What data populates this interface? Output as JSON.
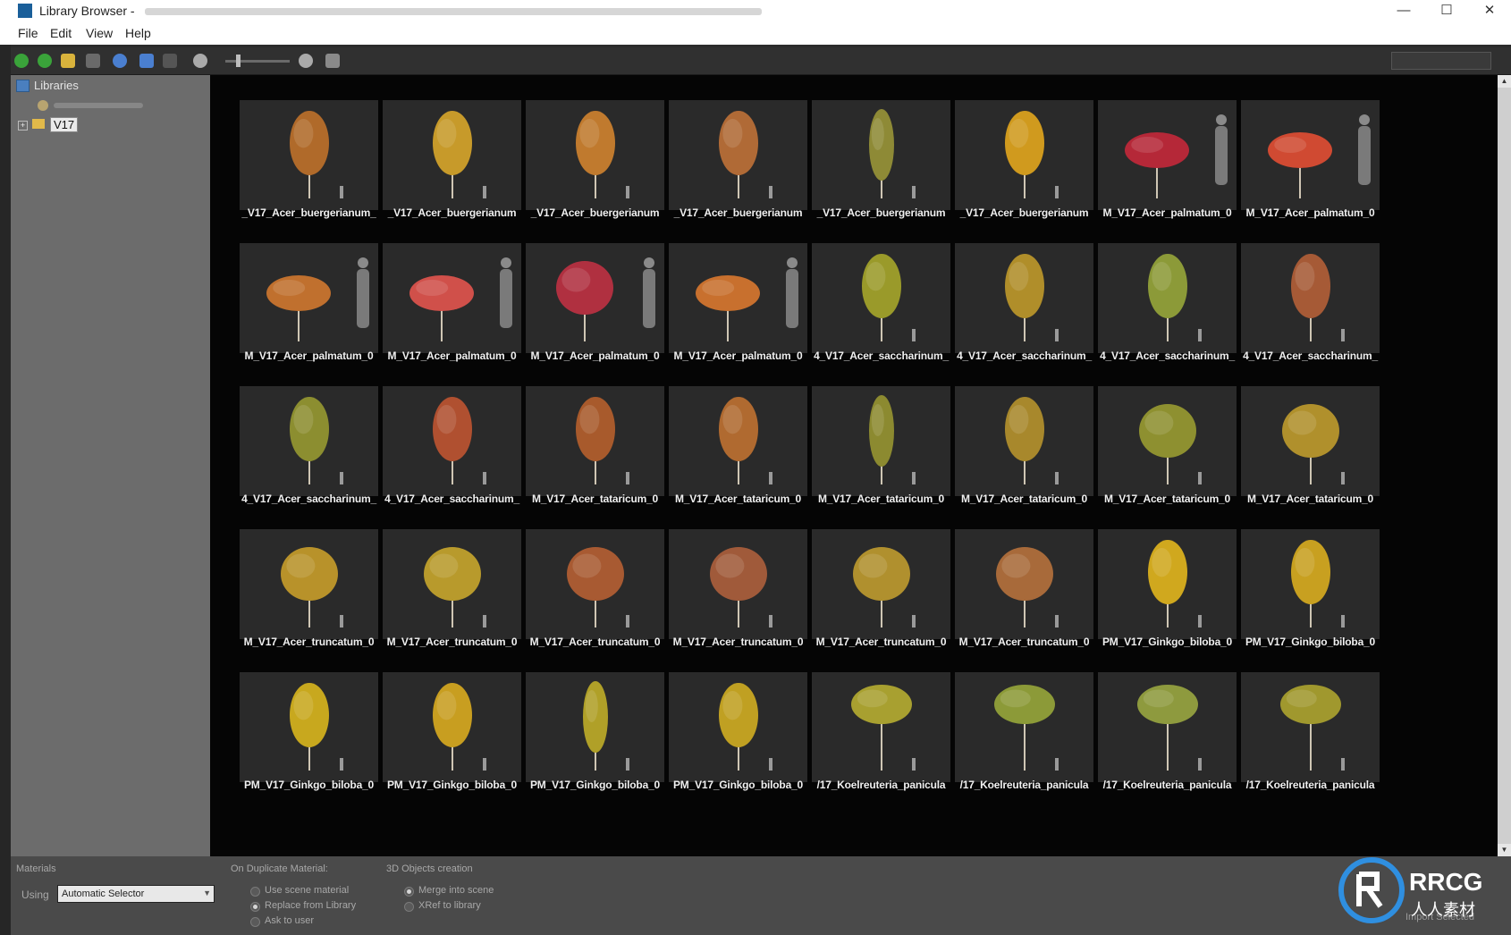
{
  "window": {
    "title": "Library Browser -",
    "controls": {
      "minimize": "—",
      "maximize": "☐",
      "close": "✕"
    }
  },
  "menu": {
    "file": "File",
    "edit": "Edit",
    "view": "View",
    "help": "Help"
  },
  "toolbar": {
    "icons": [
      "back-icon",
      "forward-icon",
      "folder-open-icon",
      "save-icon",
      "refresh-icon",
      "upload-icon",
      "export-icon",
      "zoom-out-icon",
      "zoom-slider",
      "zoom-in-icon",
      "settings-icon"
    ],
    "colors": {
      "green": "#3aa33a",
      "gray": "#7a7a7a",
      "blue": "#4a7fd0",
      "yellow": "#d9b33c"
    }
  },
  "tree": {
    "header": "Libraries",
    "selected_folder": "V17",
    "expander": "+"
  },
  "grid": {
    "items": [
      {
        "label": "_V17_Acer_buergerianum_",
        "color": "#b06a2a",
        "shape": "tall",
        "person": false
      },
      {
        "label": "_V17_Acer_buergerianum",
        "color": "#c79a2a",
        "shape": "tall",
        "person": false
      },
      {
        "label": "_V17_Acer_buergerianum",
        "color": "#c07a2e",
        "shape": "tall",
        "person": false
      },
      {
        "label": "_V17_Acer_buergerianum",
        "color": "#b06a36",
        "shape": "tall",
        "person": false
      },
      {
        "label": "_V17_Acer_buergerianum",
        "color": "#8e8a36",
        "shape": "slim",
        "person": false
      },
      {
        "label": "_V17_Acer_buergerianum",
        "color": "#d09a1e",
        "shape": "tall",
        "person": false
      },
      {
        "label": "M_V17_Acer_palmatum_0",
        "color": "#b52838",
        "shape": "wide",
        "person": true
      },
      {
        "label": "M_V17_Acer_palmatum_0",
        "color": "#d04a32",
        "shape": "wide",
        "person": true
      },
      {
        "label": "M_V17_Acer_palmatum_0",
        "color": "#c0702e",
        "shape": "wide",
        "person": true
      },
      {
        "label": "M_V17_Acer_palmatum_0",
        "color": "#d0504a",
        "shape": "wide",
        "person": true
      },
      {
        "label": "M_V17_Acer_palmatum_0",
        "color": "#b03040",
        "shape": "round",
        "person": true
      },
      {
        "label": "M_V17_Acer_palmatum_0",
        "color": "#c8702e",
        "shape": "wide",
        "person": true
      },
      {
        "label": "4_V17_Acer_saccharinum_",
        "color": "#9a9a2a",
        "shape": "tall",
        "person": false
      },
      {
        "label": "4_V17_Acer_saccharinum_",
        "color": "#b08e2a",
        "shape": "tall",
        "person": false
      },
      {
        "label": "4_V17_Acer_saccharinum_",
        "color": "#8c9a38",
        "shape": "tall",
        "person": false
      },
      {
        "label": "4_V17_Acer_saccharinum_",
        "color": "#a65a36",
        "shape": "tall",
        "person": false
      },
      {
        "label": "4_V17_Acer_saccharinum_",
        "color": "#8c8e30",
        "shape": "tall",
        "person": false
      },
      {
        "label": "4_V17_Acer_saccharinum_",
        "color": "#b05030",
        "shape": "tall",
        "person": false
      },
      {
        "label": "M_V17_Acer_tataricum_0",
        "color": "#a85a2c",
        "shape": "tall",
        "person": false
      },
      {
        "label": "M_V17_Acer_tataricum_0",
        "color": "#b06a30",
        "shape": "tall",
        "person": false
      },
      {
        "label": "M_V17_Acer_tataricum_0",
        "color": "#8c8a30",
        "shape": "slim",
        "person": false
      },
      {
        "label": "M_V17_Acer_tataricum_0",
        "color": "#a8882c",
        "shape": "tall",
        "person": false
      },
      {
        "label": "M_V17_Acer_tataricum_0",
        "color": "#8e9030",
        "shape": "round",
        "person": false
      },
      {
        "label": "M_V17_Acer_tataricum_0",
        "color": "#b0902c",
        "shape": "round",
        "person": false
      },
      {
        "label": "M_V17_Acer_truncatum_0",
        "color": "#b8922a",
        "shape": "round",
        "person": false
      },
      {
        "label": "M_V17_Acer_truncatum_0",
        "color": "#b89a2c",
        "shape": "round",
        "person": false
      },
      {
        "label": "M_V17_Acer_truncatum_0",
        "color": "#a85a32",
        "shape": "round",
        "person": false
      },
      {
        "label": "M_V17_Acer_truncatum_0",
        "color": "#a05a3a",
        "shape": "round",
        "person": false
      },
      {
        "label": "M_V17_Acer_truncatum_0",
        "color": "#b0902e",
        "shape": "round",
        "person": false
      },
      {
        "label": "M_V17_Acer_truncatum_0",
        "color": "#a86a3a",
        "shape": "round",
        "person": false
      },
      {
        "label": "PM_V17_Ginkgo_biloba_0",
        "color": "#d0a81e",
        "shape": "tall",
        "person": false
      },
      {
        "label": "PM_V17_Ginkgo_biloba_0",
        "color": "#c8a020",
        "shape": "tall",
        "person": false
      },
      {
        "label": "PM_V17_Ginkgo_biloba_0",
        "color": "#c8a81e",
        "shape": "tall",
        "person": false
      },
      {
        "label": "PM_V17_Ginkgo_biloba_0",
        "color": "#c89e20",
        "shape": "tall",
        "person": false
      },
      {
        "label": "PM_V17_Ginkgo_biloba_0",
        "color": "#b0a028",
        "shape": "slim",
        "person": false
      },
      {
        "label": "PM_V17_Ginkgo_biloba_0",
        "color": "#c0a022",
        "shape": "tall",
        "person": false
      },
      {
        "label": "/17_Koelreuteria_panicula",
        "color": "#a8a030",
        "shape": "canopy",
        "person": false
      },
      {
        "label": "/17_Koelreuteria_panicula",
        "color": "#8c9a38",
        "shape": "canopy",
        "person": false
      },
      {
        "label": "/17_Koelreuteria_panicula",
        "color": "#8e9a3e",
        "shape": "canopy",
        "person": false
      },
      {
        "label": "/17_Koelreuteria_panicula",
        "color": "#a0982e",
        "shape": "canopy",
        "person": false
      }
    ]
  },
  "bottom": {
    "materials_title": "Materials",
    "using_label": "Using",
    "using_value": "Automatic Selector",
    "duplicate_title": "On Duplicate Material:",
    "duplicate_options": [
      {
        "label": "Use scene material",
        "checked": false
      },
      {
        "label": "Replace from Library",
        "checked": true
      },
      {
        "label": "Ask to user",
        "checked": false
      }
    ],
    "objects_title": "3D Objects creation",
    "objects_options": [
      {
        "label": "Merge into scene",
        "checked": true
      },
      {
        "label": "XRef to library",
        "checked": false
      }
    ],
    "import_button": "Import Selected"
  },
  "watermark": {
    "brand": "RRCG",
    "subtitle": "人人素材"
  }
}
